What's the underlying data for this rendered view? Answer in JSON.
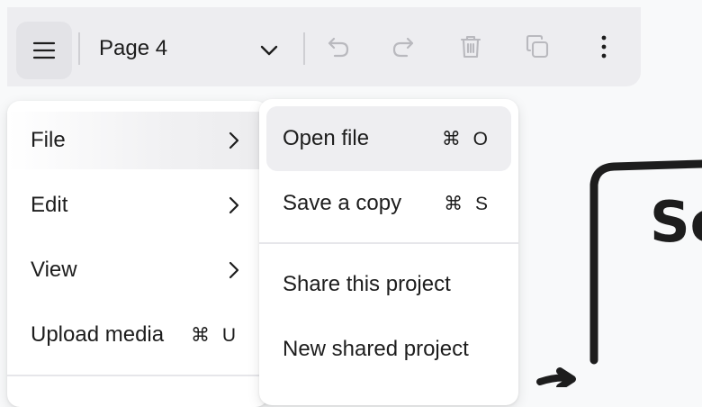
{
  "toolbar": {
    "page_name": "Page 4",
    "icons": [
      "hamburger-menu-icon",
      "chevron-down-icon",
      "undo-icon",
      "redo-icon",
      "trash-icon",
      "duplicate-icon",
      "more-vertical-icon"
    ]
  },
  "main_menu": {
    "items": [
      {
        "label": "File",
        "has_submenu": true
      },
      {
        "label": "Edit",
        "has_submenu": true
      },
      {
        "label": "View",
        "has_submenu": true
      },
      {
        "label": "Upload media",
        "shortcut": "⌘ U"
      }
    ]
  },
  "file_submenu": {
    "items": [
      {
        "label": "Open file",
        "shortcut": "⌘ O"
      },
      {
        "label": "Save a copy",
        "shortcut": "⌘ S"
      },
      {
        "label": "Share this project"
      },
      {
        "label": "New shared project"
      }
    ]
  },
  "canvas": {
    "text": "Se"
  },
  "colors": {
    "toolbar_bg": "#ededf0",
    "menu_bg": "#ffffff",
    "highlight": "#eeeef1",
    "text": "#1d1d1d",
    "disabled_icon": "#b9b9be"
  }
}
